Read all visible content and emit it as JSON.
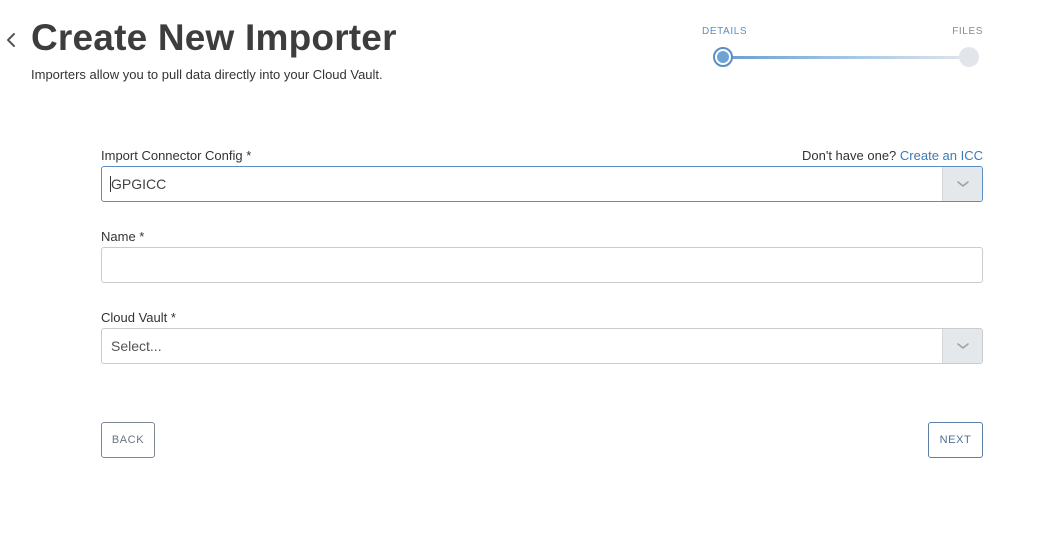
{
  "header": {
    "title": "Create New Importer",
    "subtitle": "Importers allow you to pull data directly into your Cloud Vault.",
    "back_icon": "chevron-left-icon"
  },
  "stepper": {
    "steps": [
      {
        "label": "DETAILS",
        "state": "active"
      },
      {
        "label": "FILES",
        "state": "inactive"
      }
    ],
    "active_color": "#5b8ec4"
  },
  "form": {
    "import_connector_config": {
      "label": "Import Connector Config *",
      "help_text": "Don't have one?",
      "help_link": "Create an ICC",
      "value": "GPGICC",
      "arrow_icon": "chevron-down-icon"
    },
    "name": {
      "label": "Name *",
      "value": "",
      "placeholder": ""
    },
    "cloud_vault": {
      "label": "Cloud Vault *",
      "placeholder": "Select...",
      "arrow_icon": "chevron-down-icon"
    }
  },
  "actions": {
    "back_label": "BACK",
    "next_label": "NEXT"
  },
  "colors": {
    "link": "#3b7ab8",
    "title": "#3d3d3d",
    "border": "#c8ccd0"
  }
}
